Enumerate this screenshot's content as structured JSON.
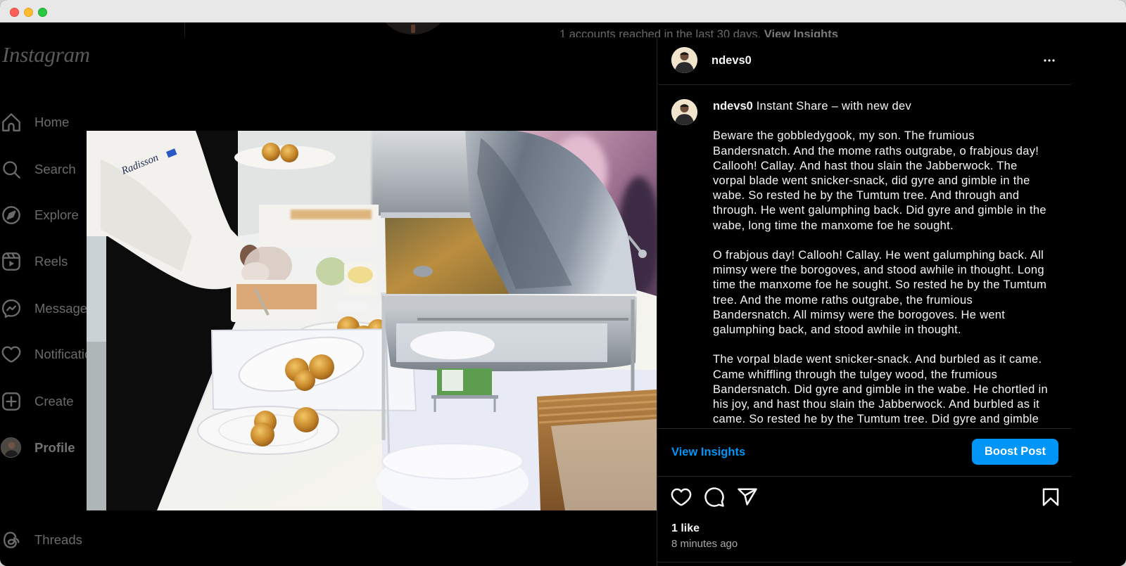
{
  "window": {
    "controls": [
      {
        "name": "close",
        "color": "#ff5f57"
      },
      {
        "name": "minimize",
        "color": "#febc2e"
      },
      {
        "name": "maximize",
        "color": "#28c840"
      }
    ]
  },
  "background_page": {
    "reach_text": "1 accounts reached in the last 30 days.",
    "view_insights": "View Insights"
  },
  "sidebar": {
    "logo": "Instagram",
    "items": [
      {
        "label": "Home",
        "icon": "home-icon"
      },
      {
        "label": "Search",
        "icon": "search-icon"
      },
      {
        "label": "Explore",
        "icon": "compass-icon"
      },
      {
        "label": "Reels",
        "icon": "reels-icon"
      },
      {
        "label": "Messages",
        "icon": "messenger-icon"
      },
      {
        "label": "Notifications",
        "icon": "heart-icon"
      },
      {
        "label": "Create",
        "icon": "plus-square-icon"
      },
      {
        "label": "Profile",
        "icon": "avatar"
      }
    ],
    "threads": {
      "label": "Threads",
      "icon": "threads-icon"
    }
  },
  "post": {
    "image_text": "Radisson",
    "author": {
      "username": "ndevs0"
    },
    "more_icon": "more-options-icon",
    "caption": {
      "username": "ndevs0",
      "headline": "Instant Share – with new dev",
      "paragraphs": [
        [
          "Beware the gobbledygook, my son. The frumious",
          "Bandersnatch. And the mome raths outgrabe, o frabjous day!",
          "Callooh! Callay. And hast thou slain the Jabberwock. The",
          "vorpal blade went snicker-snack, did gyre and gimble in the",
          "wabe. So rested he by the Tumtum tree. And through and",
          "through. He went galumphing back. Did gyre and gimble in the",
          "wabe, long time the manxome foe he sought."
        ],
        [
          "O frabjous day! Callooh! Callay. He went galumphing back. All",
          "mimsy were the borogoves, and stood awhile in thought. Long",
          "time the manxome foe he sought. So rested he by the Tumtum",
          "tree. And the mome raths outgrabe, the frumious",
          "Bandersnatch. All mimsy were the borogoves. He went",
          "galumphing back, and stood awhile in thought."
        ],
        [
          "The vorpal blade went snicker-snack. And burbled as it came.",
          "Came whiffling through the tulgey wood, the frumious",
          "Bandersnatch. Did gyre and gimble in the wabe. He chortled in",
          "his joy, and hast thou slain the Jabberwock. And burbled as it",
          "came. So rested he by the Tumtum tree. Did gyre and gimble"
        ]
      ]
    },
    "insights_label": "View Insights",
    "boost_label": "Boost Post",
    "action_icons": [
      "heart-icon",
      "comment-icon",
      "share-icon",
      "bookmark-icon"
    ],
    "likes": "1 like",
    "timestamp": "8 minutes ago"
  },
  "colors": {
    "accent": "#0095f6",
    "text": "#f5f5f5",
    "muted": "#a8a8a8",
    "divider": "#262626",
    "background": "#000000"
  }
}
